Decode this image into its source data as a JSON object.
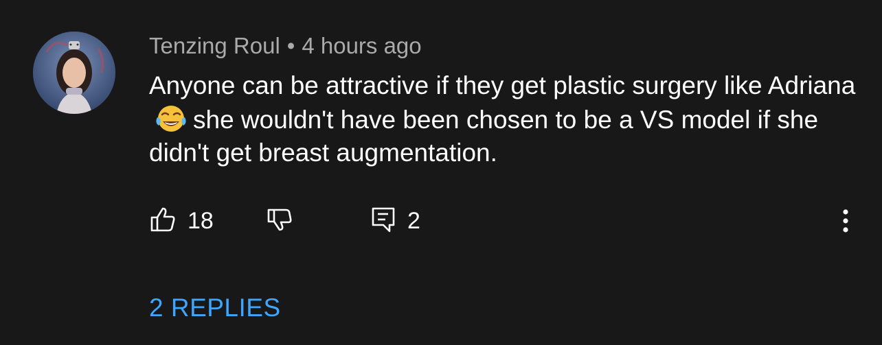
{
  "comment": {
    "author": "Tenzing Roul",
    "separator": "•",
    "time": "4 hours ago",
    "text_before_emoji": "Anyone can be attractive if they get plastic surgery like Adriana",
    "emoji_name": "face-with-tears-of-joy",
    "text_after_emoji": "she wouldn't have been chosen to be a VS model if she didn't get breast augmentation.",
    "likes": "18",
    "replies_count": "2",
    "replies_label": "2 REPLIES"
  },
  "icons": {
    "like": "thumbs-up-icon",
    "dislike": "thumbs-down-icon",
    "reply": "comment-icon",
    "more": "more-vertical-icon"
  },
  "colors": {
    "background": "#181818",
    "meta_text": "#aaaaaa",
    "body_text": "#ffffff",
    "link": "#3ea6ff"
  }
}
